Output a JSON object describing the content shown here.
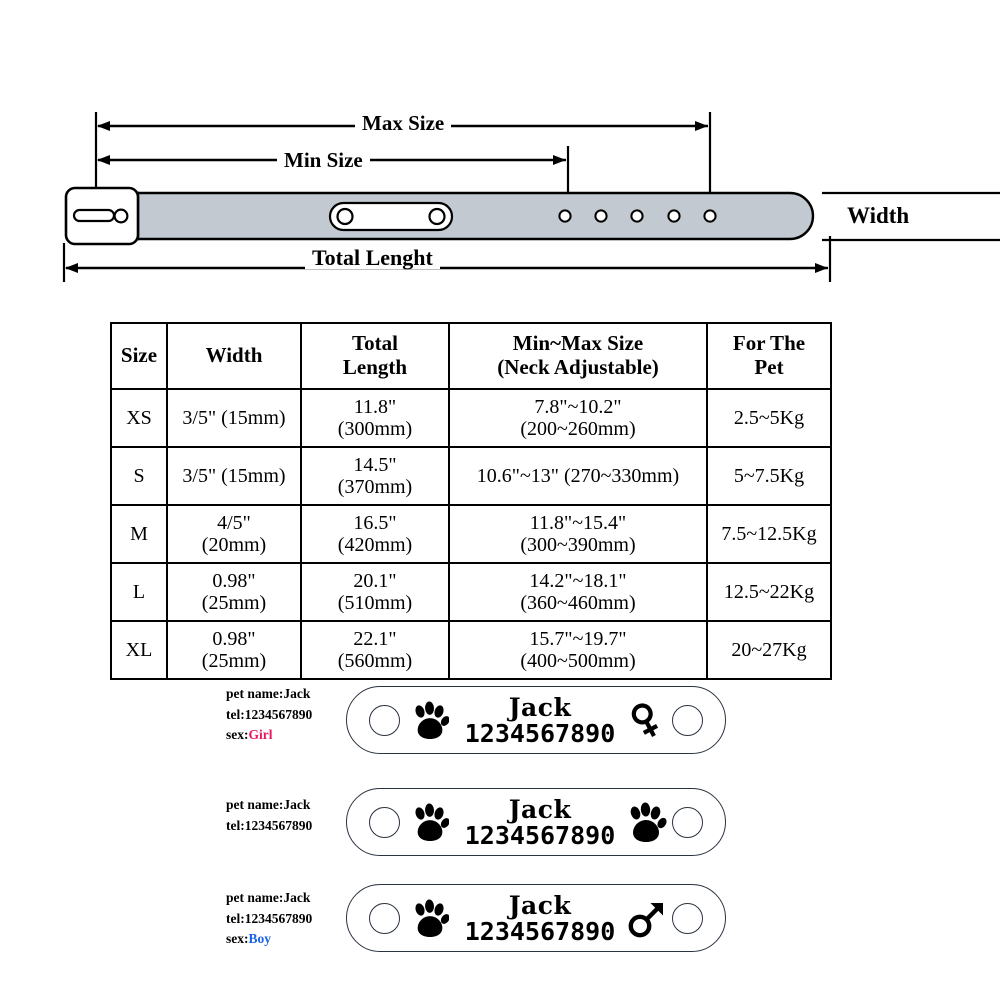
{
  "diagram": {
    "max_size_label": "Max Size",
    "min_size_label": "Min  Size",
    "total_length_label": "Total Lenght",
    "width_label": "Width",
    "strap_color": "#c3c9d0",
    "outline_color": "#000000",
    "adjustment_hole_count": 5,
    "nameplate_hole_count": 2
  },
  "table": {
    "headers": [
      {
        "label": "Size",
        "lines": [
          "Size"
        ]
      },
      {
        "label": "Width",
        "lines": [
          "Width"
        ]
      },
      {
        "label": "Total Length",
        "lines": [
          "Total",
          "Length"
        ]
      },
      {
        "label": "Min~Max Size (Neck Adjustable)",
        "lines": [
          "Min~Max Size",
          "(Neck Adjustable)"
        ]
      },
      {
        "label": "For The Pet",
        "lines": [
          "For The",
          "Pet"
        ]
      }
    ],
    "rows": [
      {
        "size": "XS",
        "width": [
          "3/5\" (15mm)"
        ],
        "total_length": [
          "11.8\"",
          "(300mm)"
        ],
        "min_max": [
          "7.8\"~10.2\"",
          "(200~260mm)"
        ],
        "for_the_pet": [
          "2.5~5Kg"
        ]
      },
      {
        "size": "S",
        "width": [
          "3/5\" (15mm)"
        ],
        "total_length": [
          "14.5\"",
          "(370mm)"
        ],
        "min_max": [
          "10.6\"~13\" (270~330mm)"
        ],
        "for_the_pet": [
          "5~7.5Kg"
        ]
      },
      {
        "size": "M",
        "width": [
          "4/5\"",
          "(20mm)"
        ],
        "total_length": [
          "16.5\"",
          "(420mm)"
        ],
        "min_max": [
          "11.8\"~15.4\"",
          "(300~390mm)"
        ],
        "for_the_pet": [
          "7.5~12.5Kg"
        ]
      },
      {
        "size": "L",
        "width": [
          "0.98\"",
          "(25mm)"
        ],
        "total_length": [
          "20.1\"",
          "(510mm)"
        ],
        "min_max": [
          "14.2\"~18.1\"",
          "(360~460mm)"
        ],
        "for_the_pet": [
          "12.5~22Kg"
        ]
      },
      {
        "size": "XL",
        "width": [
          "0.98\"",
          "(25mm)"
        ],
        "total_length": [
          "22.1\"",
          "(560mm)"
        ],
        "min_max": [
          "15.7\"~19.7\"",
          "(400~500mm)"
        ],
        "for_the_pet": [
          "20~27Kg"
        ]
      }
    ]
  },
  "tags": [
    {
      "annotation": {
        "pet_name": "pet name:Jack",
        "tel": "tel:1234567890",
        "sex_label": "sex:",
        "sex_value": "Girl",
        "sex_color": "#e8175d"
      },
      "engraved_name": "Jack",
      "engraved_phone": "1234567890",
      "left_glyph": "paw-icon",
      "right_glyph": "female-symbol-icon"
    },
    {
      "annotation": {
        "pet_name": "pet name:Jack",
        "tel": "tel:1234567890",
        "sex_label": "",
        "sex_value": "",
        "sex_color": ""
      },
      "engraved_name": "Jack",
      "engraved_phone": "1234567890",
      "left_glyph": "paw-icon",
      "right_glyph": "paw-icon"
    },
    {
      "annotation": {
        "pet_name": "pet name:Jack",
        "tel": "tel:1234567890",
        "sex_label": "sex:",
        "sex_value": "Boy",
        "sex_color": "#1a63e8"
      },
      "engraved_name": "Jack",
      "engraved_phone": "1234567890",
      "left_glyph": "paw-icon",
      "right_glyph": "male-symbol-icon"
    }
  ]
}
